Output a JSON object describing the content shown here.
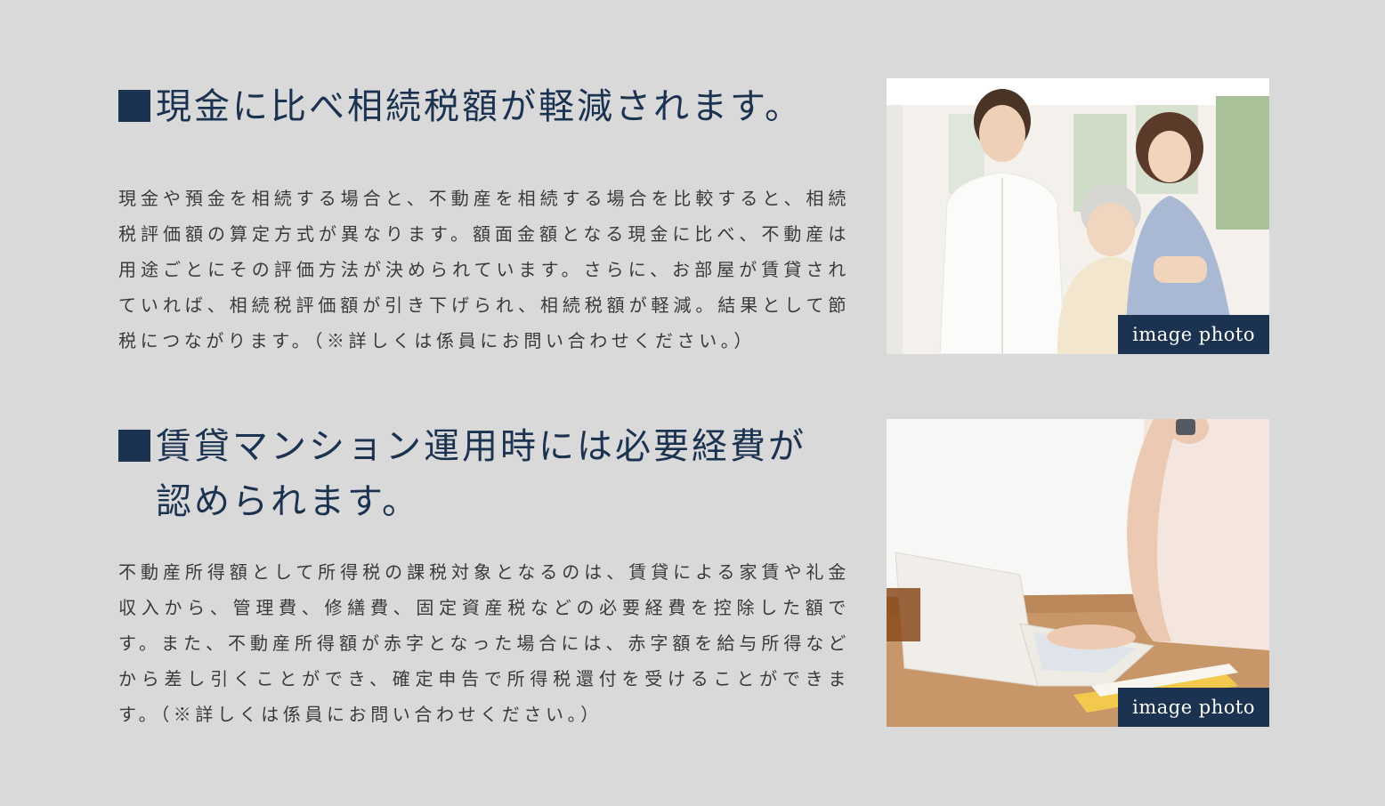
{
  "sections": [
    {
      "title_line1": "現金に比べ相続税額が軽減されます。",
      "title_line2": "",
      "body": "現金や預金を相続する場合と、不動産を相続する場合を比較すると、相続税評価額の算定方式が異なります。額面金額となる現金に比べ、不動産は用途ごとにその評価方法が決められています。さらに、お部屋が賃貸されていれば、相続税評価額が引き下げられ、相続税額が軽減。結果として節税につながります。（※詳しくは係員にお問い合わせください。）",
      "photo_label": "image photo",
      "photo_icon": "family-photo"
    },
    {
      "title_line1": "賃貸マンション運用時には必要経費が",
      "title_line2": "認められます。",
      "body": "不動産所得額として所得税の課税対象となるのは、賃貸による家賃や礼金収入から、管理費、修繕費、固定資産税などの必要経費を控除した額です。また、不動産所得額が赤字となった場合には、赤字額を給与所得などから差し引くことができ、確定申告で所得税還付を受けることができます。（※詳しくは係員にお問い合わせください。）",
      "photo_label": "image photo",
      "photo_icon": "laptop-phone-photo"
    }
  ],
  "colors": {
    "background": "#d9d9d9",
    "heading": "#1b3250",
    "body_text": "#3a3a3a",
    "label_bg": "#1b3250"
  }
}
